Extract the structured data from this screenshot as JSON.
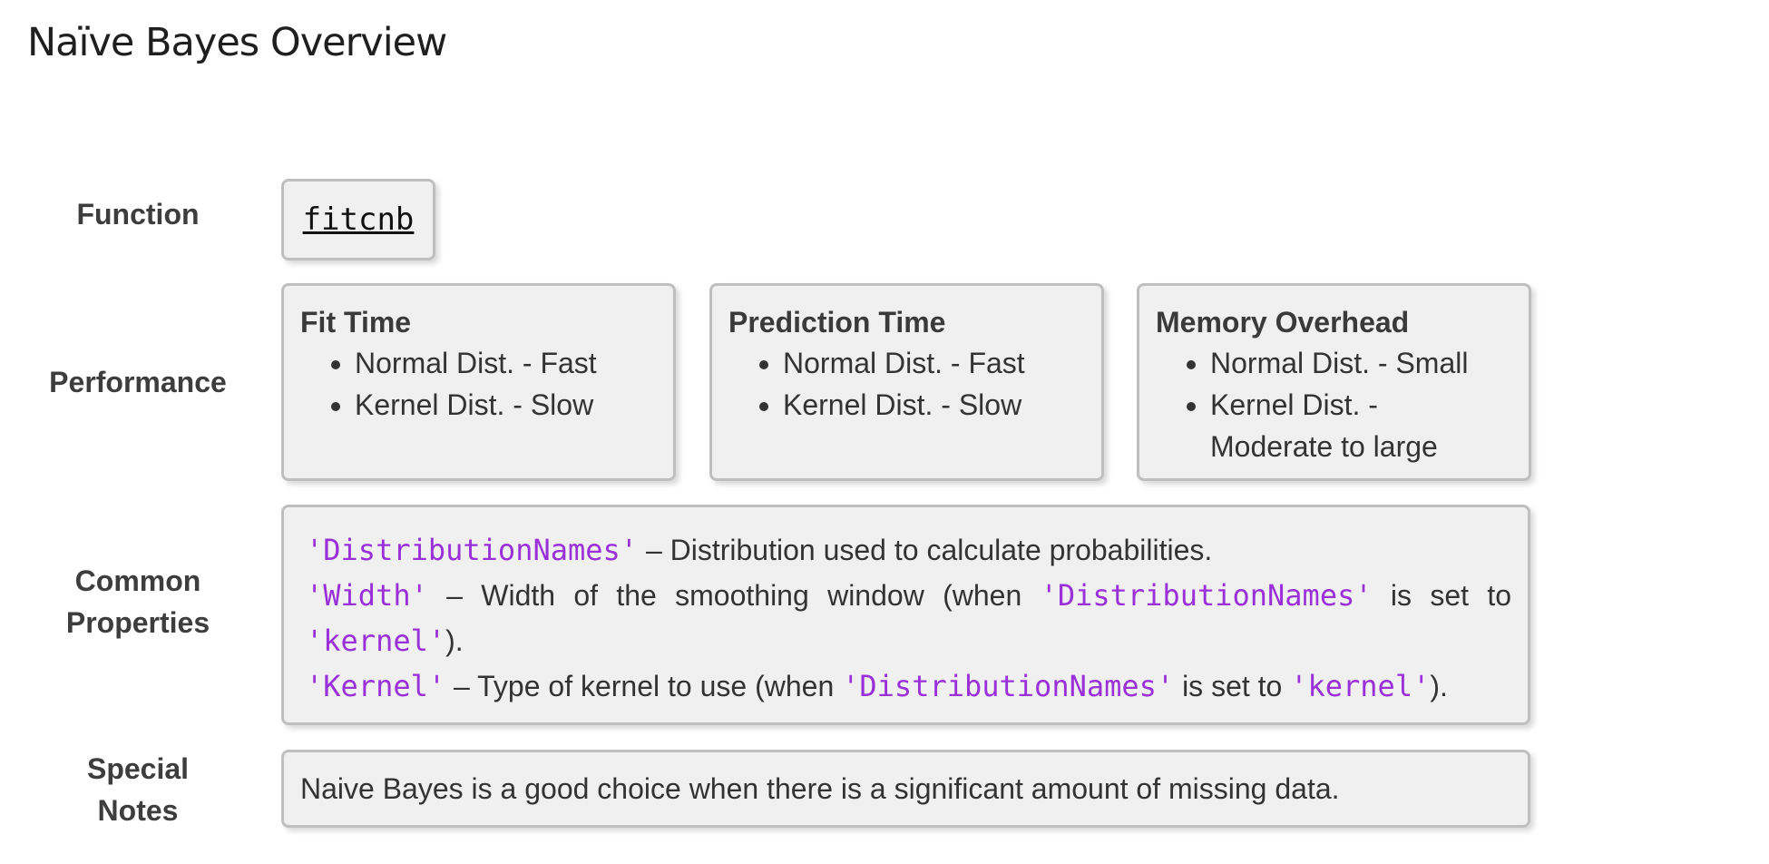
{
  "page": {
    "title": "Naïve Bayes Overview"
  },
  "labels": {
    "function": "Function",
    "performance": "Performance",
    "common_properties_line1": "Common",
    "common_properties_line2": "Properties",
    "special_notes_line1": "Special",
    "special_notes_line2": "Notes"
  },
  "function": {
    "name": "fitcnb"
  },
  "performance": [
    {
      "title": "Fit Time",
      "items": [
        "Normal Dist. - Fast",
        "Kernel Dist. - Slow"
      ]
    },
    {
      "title": "Prediction Time",
      "items": [
        "Normal Dist. - Fast",
        "Kernel Dist. - Slow"
      ]
    },
    {
      "title": "Memory Overhead",
      "items": [
        "Normal Dist. - Small",
        "Kernel Dist. - Moderate to large"
      ]
    }
  ],
  "properties": {
    "distnames_code": "'DistributionNames'",
    "distnames_desc": " – Distribution used to calculate probabilities.",
    "width_code": "'Width'",
    "width_desc": " – Width of the smoothing window (when ",
    "width_ref_code": "'DistributionNames'",
    "width_mid": " is set to",
    "width_kernel_code": "'kernel'",
    "width_end": ").",
    "kernel_code": "'Kernel'",
    "kernel_desc": " – Type of kernel to use (when ",
    "kernel_ref_code": "'DistributionNames'",
    "kernel_mid": " is set to ",
    "kernel_kernel_code": "'kernel'",
    "kernel_end": ")."
  },
  "notes": {
    "text": "Naive Bayes is a good choice when there is a significant amount of missing data."
  },
  "colors": {
    "code_text": "#9a30d8",
    "box_background": "#f0f0f0",
    "box_border": "#bfbfbf"
  }
}
